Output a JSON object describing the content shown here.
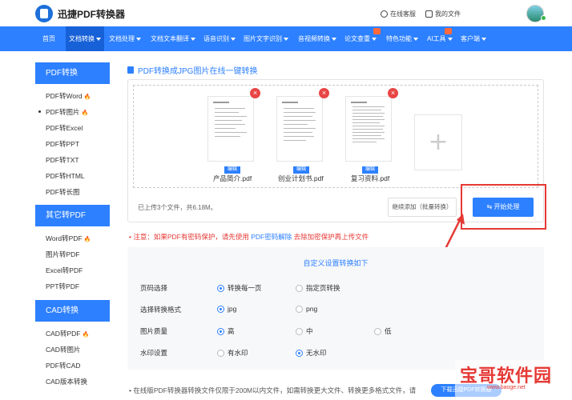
{
  "header": {
    "logo_text": "迅捷PDF转换器",
    "online_service": "在线客服",
    "my_files": "我的文件"
  },
  "nav": {
    "items": [
      {
        "label": "首页",
        "caret": false
      },
      {
        "label": "文档转换",
        "caret": true
      },
      {
        "label": "文档处理",
        "caret": true
      },
      {
        "label": "文档文本翻译",
        "caret": true
      },
      {
        "label": "语音识别",
        "caret": true
      },
      {
        "label": "图片文字识别",
        "caret": true
      },
      {
        "label": "音视频转换",
        "caret": true
      },
      {
        "label": "论文查重",
        "caret": true
      },
      {
        "label": "特色功能",
        "caret": true
      },
      {
        "label": "AI工具",
        "caret": true
      },
      {
        "label": "客户端",
        "caret": true
      }
    ]
  },
  "sidebar": {
    "sections": [
      {
        "title": "PDF转换",
        "items": [
          "PDF转Word",
          "PDF转图片",
          "PDF转Excel",
          "PDF转PPT",
          "PDF转TXT",
          "PDF转HTML",
          "PDF转长图"
        ]
      },
      {
        "title": "其它转PDF",
        "items": [
          "Word转PDF",
          "图片转PDF",
          "Excel转PDF",
          "PPT转PDF"
        ]
      },
      {
        "title": "CAD转换",
        "items": [
          "CAD转PDF",
          "CAD转图片",
          "PDF转CAD",
          "CAD版本转换"
        ]
      }
    ]
  },
  "main": {
    "title": "PDF转换成JPG图片在线一键转换",
    "files": [
      {
        "name": "产品简介.pdf",
        "edit": "编辑"
      },
      {
        "name": "创业计划书.pdf",
        "edit": "编辑"
      },
      {
        "name": "复习资料.pdf",
        "edit": "编辑"
      }
    ],
    "upload_info": "已上传3个文件，共6.18M。",
    "continue_button": "继续添加（批量转换）",
    "start_button": "开始处理"
  },
  "notice": {
    "prefix": "注意：如果PDF有密码保护，请先使用",
    "link": "PDF密码解除",
    "suffix": "去除加密保护再上传文件"
  },
  "settings": {
    "title": "自定义设置转换如下",
    "rows": [
      {
        "label": "页码选择",
        "options": [
          {
            "text": "转换每一页",
            "selected": true
          },
          {
            "text": "指定页转换",
            "selected": false
          }
        ]
      },
      {
        "label": "选择转换格式",
        "options": [
          {
            "text": "jpg",
            "selected": true
          },
          {
            "text": "png",
            "selected": false
          }
        ]
      },
      {
        "label": "图片质量",
        "options": [
          {
            "text": "高",
            "selected": true
          },
          {
            "text": "中",
            "selected": false
          },
          {
            "text": "低",
            "selected": false
          }
        ]
      },
      {
        "label": "水印设置",
        "options": [
          {
            "text": "有水印",
            "selected": false
          },
          {
            "text": "无水印",
            "selected": true
          }
        ]
      }
    ]
  },
  "footer": {
    "note": "在线版PDF转换器转换文件仅限于200M以内文件，如需转换更大文件、转换更多格式文件，请",
    "download_button": "下载迅捷PDF转换器"
  },
  "watermark": {
    "text": "宝哥软件园",
    "url": "www.baoge.net"
  },
  "colors": {
    "accent": "#2d80ff",
    "highlight_frame": "#e53935"
  }
}
